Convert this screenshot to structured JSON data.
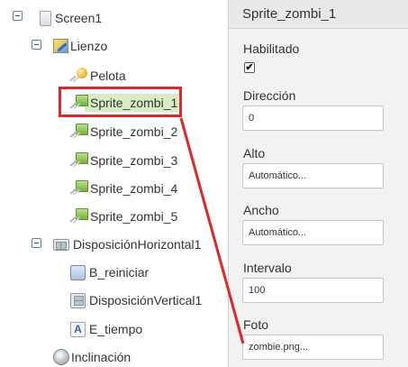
{
  "tree": {
    "items": [
      {
        "label": "Screen1",
        "icon": "screen-icon"
      },
      {
        "label": "Lienzo",
        "icon": "canvas-icon"
      },
      {
        "label": "Pelota",
        "icon": "ball-sprite-icon"
      },
      {
        "label": "Sprite_zombi_1",
        "icon": "image-sprite-icon",
        "selected": true
      },
      {
        "label": "Sprite_zombi_2",
        "icon": "image-sprite-icon"
      },
      {
        "label": "Sprite_zombi_3",
        "icon": "image-sprite-icon"
      },
      {
        "label": "Sprite_zombi_4",
        "icon": "image-sprite-icon"
      },
      {
        "label": "Sprite_zombi_5",
        "icon": "image-sprite-icon"
      },
      {
        "label": "DisposiciónHorizontal1",
        "icon": "horizontal-arrangement-icon"
      },
      {
        "label": "B_reiniciar",
        "icon": "button-icon"
      },
      {
        "label": "DisposiciónVertical1",
        "icon": "vertical-arrangement-icon"
      },
      {
        "label": "E_tiempo",
        "icon": "label-icon",
        "glyph": "A"
      },
      {
        "label": "Inclinación",
        "icon": "orientation-sensor-icon"
      }
    ]
  },
  "properties": {
    "title": "Sprite_zombi_1",
    "habilitado": {
      "label": "Habilitado",
      "checked": true,
      "check_glyph": "✔"
    },
    "direccion": {
      "label": "Dirección",
      "value": "0"
    },
    "alto": {
      "label": "Alto",
      "value": "Automático..."
    },
    "ancho": {
      "label": "Ancho",
      "value": "Automático..."
    },
    "intervalo": {
      "label": "Intervalo",
      "value": "100"
    },
    "foto": {
      "label": "Foto",
      "value": "zombie.png..."
    }
  },
  "colors": {
    "highlight_border": "#e0262b",
    "selected_background": "#d7ecc3",
    "panel_background": "#f2f2f2"
  }
}
